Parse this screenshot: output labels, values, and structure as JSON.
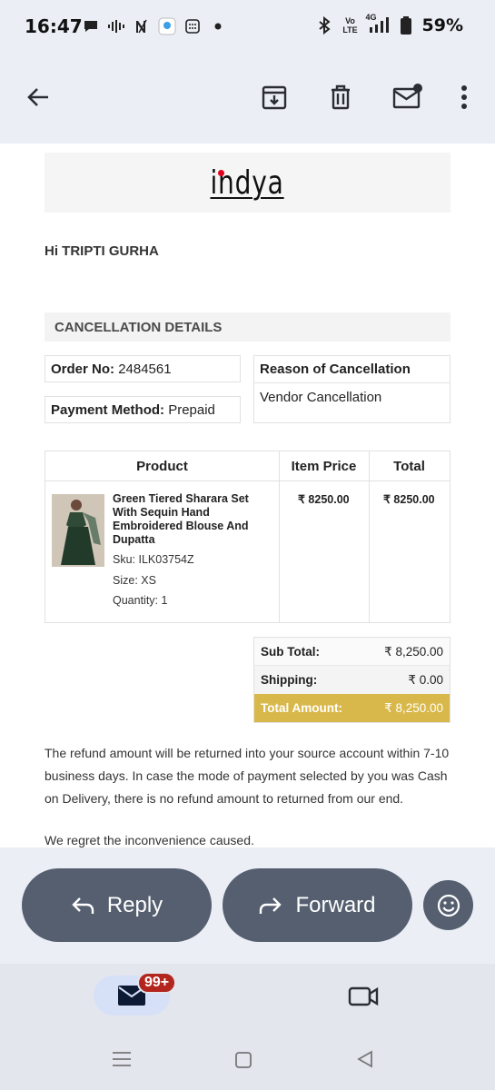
{
  "status_bar": {
    "time": "16:47",
    "battery": "59%",
    "network_label": "4G",
    "volte_label": "Vo LTE",
    "icons_left": [
      "chat-icon",
      "voice-wave-icon",
      "n-icon",
      "app-icon",
      "calendar-icon",
      "dot-icon"
    ],
    "icons_right": [
      "bluetooth-icon",
      "volte-icon",
      "signal-icon",
      "battery-icon"
    ]
  },
  "toolbar": {
    "back": "back-arrow-icon",
    "archive": "archive-icon",
    "delete": "trash-icon",
    "mark_unread": "mail-unread-icon",
    "more": "more-vert-icon"
  },
  "email": {
    "brand": "indya",
    "greeting": "Hi TRIPTI GURHA",
    "section_title": "CANCELLATION DETAILS",
    "order_no_label": "Order No:",
    "order_no_value": "2484561",
    "payment_label": "Payment Method:",
    "payment_value": "Prepaid",
    "reason_label": "Reason of Cancellation",
    "reason_value": "Vendor Cancellation",
    "table": {
      "headers": [
        "Product",
        "Item Price",
        "Total"
      ],
      "rows": [
        {
          "name": "Green Tiered Sharara Set With Sequin Hand Embroidered Blouse And Dupatta",
          "sku": "Sku: ILK03754Z",
          "size": "Size: XS",
          "quantity": "Quantity: 1",
          "item_price": "₹ 8250.00",
          "total": "₹ 8250.00"
        }
      ]
    },
    "totals": {
      "subtotal_label": "Sub Total:",
      "subtotal_value": "₹ 8,250.00",
      "shipping_label": "Shipping:",
      "shipping_value": "₹ 0.00",
      "total_label": "Total Amount:",
      "total_value": "₹ 8,250.00"
    },
    "refund_text": "The refund amount will be returned into your source account within 7-10 business days. In case the mode of payment selected by you was Cash on Delivery, there is no refund amount to returned from our end.",
    "regret_text": "We regret the inconvenience caused."
  },
  "actions": {
    "reply": "Reply",
    "forward": "Forward"
  },
  "bottom_nav": {
    "mail_badge": "99+"
  },
  "colors": {
    "accent_gold": "#d8b84a",
    "pill_bg": "#555f70",
    "badge_red": "#b3261e",
    "brand_red": "#e3001b"
  }
}
